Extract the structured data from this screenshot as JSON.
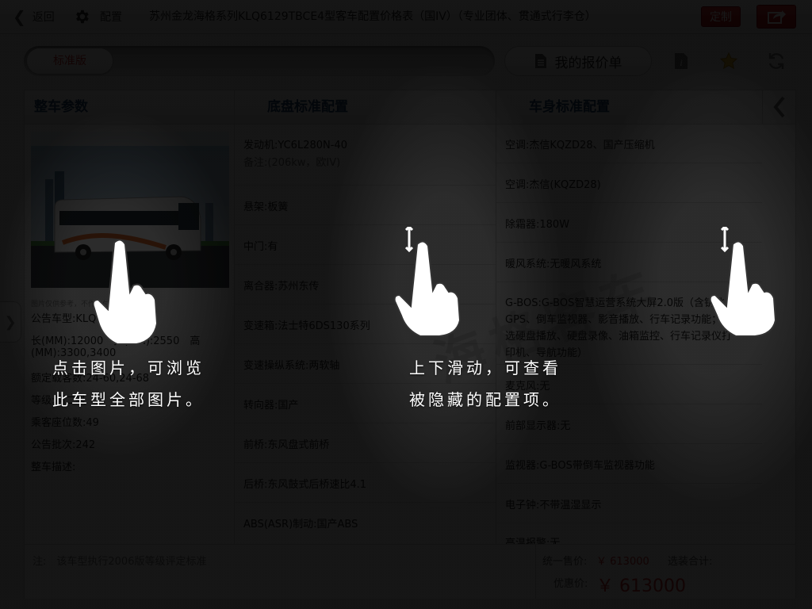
{
  "topbar": {
    "back_label": "返回",
    "config_label": "配置",
    "title": "苏州金龙海格系列KLQ6129TBCE4型客车配置价格表（国IV）（专业团体、贯通式行李仓）",
    "custom_label": "定制"
  },
  "toolbar": {
    "version_label": "标准版",
    "quote_label": "我的报价单"
  },
  "columns": {
    "vehicle": "整车参数",
    "chassis": "底盘标准配置",
    "body": "车身标准配置"
  },
  "vehicle": {
    "photo_caption": "图片仅供参考，不作交付依据",
    "specs": [
      "公告车型:KLQ6129TBCE4",
      "长(MM):12000　宽(MM):2550　高",
      "(MM):3300,3400",
      "额定载客数:24-60,24-68",
      "等级:高二级",
      "乘客座位数:49",
      "公告批次:242",
      "整车描述:"
    ]
  },
  "chassis": [
    {
      "text": "发动机:YC6L280N-40",
      "sub": "备注:(206kw，欧IV)"
    },
    {
      "text": "悬架:板簧"
    },
    {
      "text": "中门:有"
    },
    {
      "text": "离合器:苏州东传"
    },
    {
      "text": "变速箱:法士特6DS130系列"
    },
    {
      "text": "变速操纵系统:两软轴"
    },
    {
      "text": "转向器:国产"
    },
    {
      "text": "前桥:东风盘式前桥"
    },
    {
      "text": "后桥:东风鼓式后桥速比4.1"
    },
    {
      "text": "ABS(ASR)制动:国产ABS"
    }
  ],
  "body": [
    {
      "text": "空调:杰信KQZD28、国产压缩机"
    },
    {
      "text": "空调:杰信(KQZD28)"
    },
    {
      "text": "除霜器:180W"
    },
    {
      "text": "暖风系统:无暖风系统"
    },
    {
      "text": "G-BOS:G-BOS智慧运营系统大屏2.0版（含钥匙、GPS、倒车监视器、影音播放、行车记录功能；可选硬盘播放、硬盘录像、油箱监控、行车记录仪打印机、导航功能）"
    },
    {
      "text": "麦克风:无"
    },
    {
      "text": "前部显示器:无"
    },
    {
      "text": "监视器:G-BOS带倒车监视器功能"
    },
    {
      "text": "电子钟:不带温湿显示"
    },
    {
      "text": "高温报警:无"
    }
  ],
  "footer": {
    "note": "注:　该车型执行2006版等级评定标准",
    "unified_price_label": "统一售价:",
    "unified_price": "￥ 613000",
    "options_total_label": "选装合计:",
    "discount_label": "优惠价:",
    "discount_price": "￥ 613000"
  },
  "hints": {
    "left_line1": "点击图片，可浏览",
    "left_line2": "此车型全部图片。",
    "right_line1": "上下滑动，可查看",
    "right_line2": "被隐藏的配置项。"
  },
  "watermark": "海格客车",
  "colors": {
    "accent_red": "#c8282a",
    "header_blue": "#1f3f6a"
  }
}
